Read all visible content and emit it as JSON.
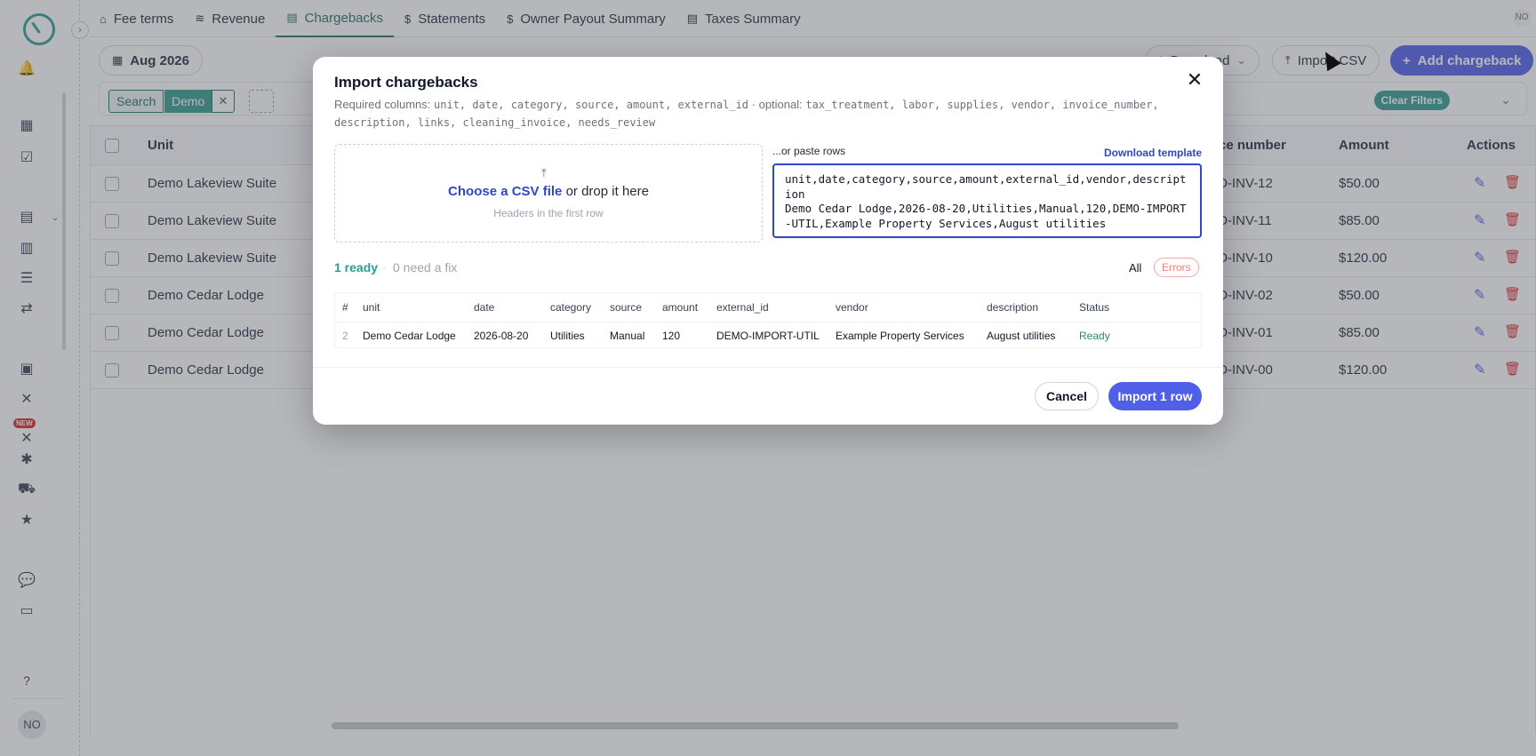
{
  "sidebar": {
    "avatar_initials": "NO",
    "new_badge": "NEW"
  },
  "tabs": [
    {
      "label": "Fee terms",
      "icon": "house-dollar-icon",
      "active": false
    },
    {
      "label": "Revenue",
      "icon": "money-icon",
      "active": false
    },
    {
      "label": "Chargebacks",
      "icon": "document-icon",
      "active": true
    },
    {
      "label": "Statements",
      "icon": "file-dollar-icon",
      "active": false
    },
    {
      "label": "Owner Payout Summary",
      "icon": "file-dollar-icon",
      "active": false
    },
    {
      "label": "Taxes Summary",
      "icon": "document-icon",
      "active": false
    }
  ],
  "top_right_initials": "NO",
  "toolbar": {
    "month": "Aug 2026",
    "download_label": "Download",
    "import_csv_label": "Import CSV",
    "add_chargeback_label": "Add chargeback"
  },
  "filters": {
    "search_label": "Search",
    "search_value": "Demo",
    "clear_label": "Clear Filters"
  },
  "table": {
    "headers": {
      "unit": "Unit",
      "invoice_number": "Invoice number",
      "amount": "Amount",
      "actions": "Actions"
    },
    "rows": [
      {
        "unit": "Demo Lakeview Suite",
        "invoice": "DEMO-INV-12",
        "amount": "$50.00"
      },
      {
        "unit": "Demo Lakeview Suite",
        "invoice": "DEMO-INV-11",
        "amount": "$85.00"
      },
      {
        "unit": "Demo Lakeview Suite",
        "invoice": "DEMO-INV-10",
        "amount": "$120.00"
      },
      {
        "unit": "Demo Cedar Lodge",
        "invoice": "DEMO-INV-02",
        "amount": "$50.00"
      },
      {
        "unit": "Demo Cedar Lodge",
        "invoice": "DEMO-INV-01",
        "amount": "$85.00"
      },
      {
        "unit": "Demo Cedar Lodge",
        "invoice": "DEMO-INV-00",
        "amount": "$120.00"
      }
    ]
  },
  "modal": {
    "title": "Import chargebacks",
    "required_label": "Required columns:",
    "required_columns": "unit, date, category, source, amount, external_id",
    "optional_label": "· optional:",
    "optional_columns": "tax_treatment, labor, supplies, vendor, invoice_number, description, links, cleaning_invoice, needs_review",
    "dropzone": {
      "choose_link": "Choose a CSV file",
      "drop_text": "or drop it here",
      "subtext": "Headers in the first row"
    },
    "paste_label": "...or paste rows",
    "download_template": "Download template",
    "paste_value": "unit,date,category,source,amount,external_id,vendor,description\nDemo Cedar Lodge,2026-08-20,Utilities,Manual,120,DEMO-IMPORT-UTIL,Example Property Services,August utilities",
    "summary": {
      "ready": "1 ready",
      "separator": "·",
      "need_fix": "0 need a fix"
    },
    "filter_all": "All",
    "filter_errors": "Errors",
    "preview": {
      "headers": [
        "#",
        "unit",
        "date",
        "category",
        "source",
        "amount",
        "external_id",
        "vendor",
        "description",
        "Status"
      ],
      "rows": [
        [
          "2",
          "Demo Cedar Lodge",
          "2026-08-20",
          "Utilities",
          "Manual",
          "120",
          "DEMO-IMPORT-UTIL",
          "Example Property Services",
          "August utilities",
          "Ready"
        ]
      ]
    },
    "cancel_label": "Cancel",
    "import_label": "Import 1 row"
  },
  "colors": {
    "primary": "#4f5fe8",
    "accent_teal": "#2f9c8f",
    "danger": "#dc2626",
    "link_blue": "#2f48c9"
  }
}
